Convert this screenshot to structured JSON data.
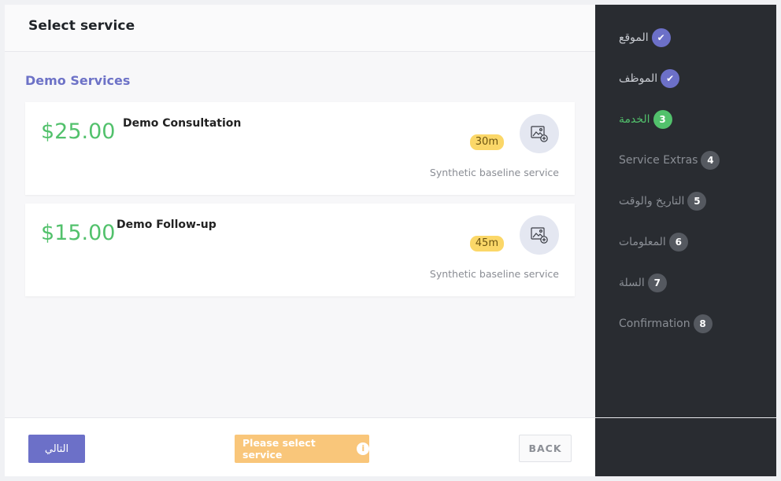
{
  "header": {
    "title": "Select service"
  },
  "section": {
    "title": "Demo Services"
  },
  "services": [
    {
      "price": "$25.00",
      "name": "Demo Consultation",
      "duration": "30m",
      "description": "Synthetic baseline service"
    },
    {
      "price": "$15.00",
      "name": "Demo Follow-up",
      "duration": "45m",
      "description": "Synthetic baseline service"
    }
  ],
  "footer": {
    "next_label": "التالي",
    "notice": "Please select service",
    "notice_icon": "info-icon",
    "back_label": "BACK"
  },
  "steps": [
    {
      "label": "الموقع",
      "badge": "✔",
      "state": "done"
    },
    {
      "label": "الموظف",
      "badge": "✔",
      "state": "done"
    },
    {
      "label": "الخدمة",
      "badge": "3",
      "state": "active"
    },
    {
      "label": "Service Extras",
      "badge": "4",
      "state": "pending"
    },
    {
      "label": "التاريخ والوقت",
      "badge": "5",
      "state": "pending"
    },
    {
      "label": "المعلومات",
      "badge": "6",
      "state": "pending"
    },
    {
      "label": "السلة",
      "badge": "7",
      "state": "pending"
    },
    {
      "label": "Confirmation",
      "badge": "8",
      "state": "pending"
    }
  ],
  "colors": {
    "accent": "#6c70c8",
    "success": "#52c16c",
    "warning": "#f9c67a",
    "sidebar": "#292c31"
  }
}
